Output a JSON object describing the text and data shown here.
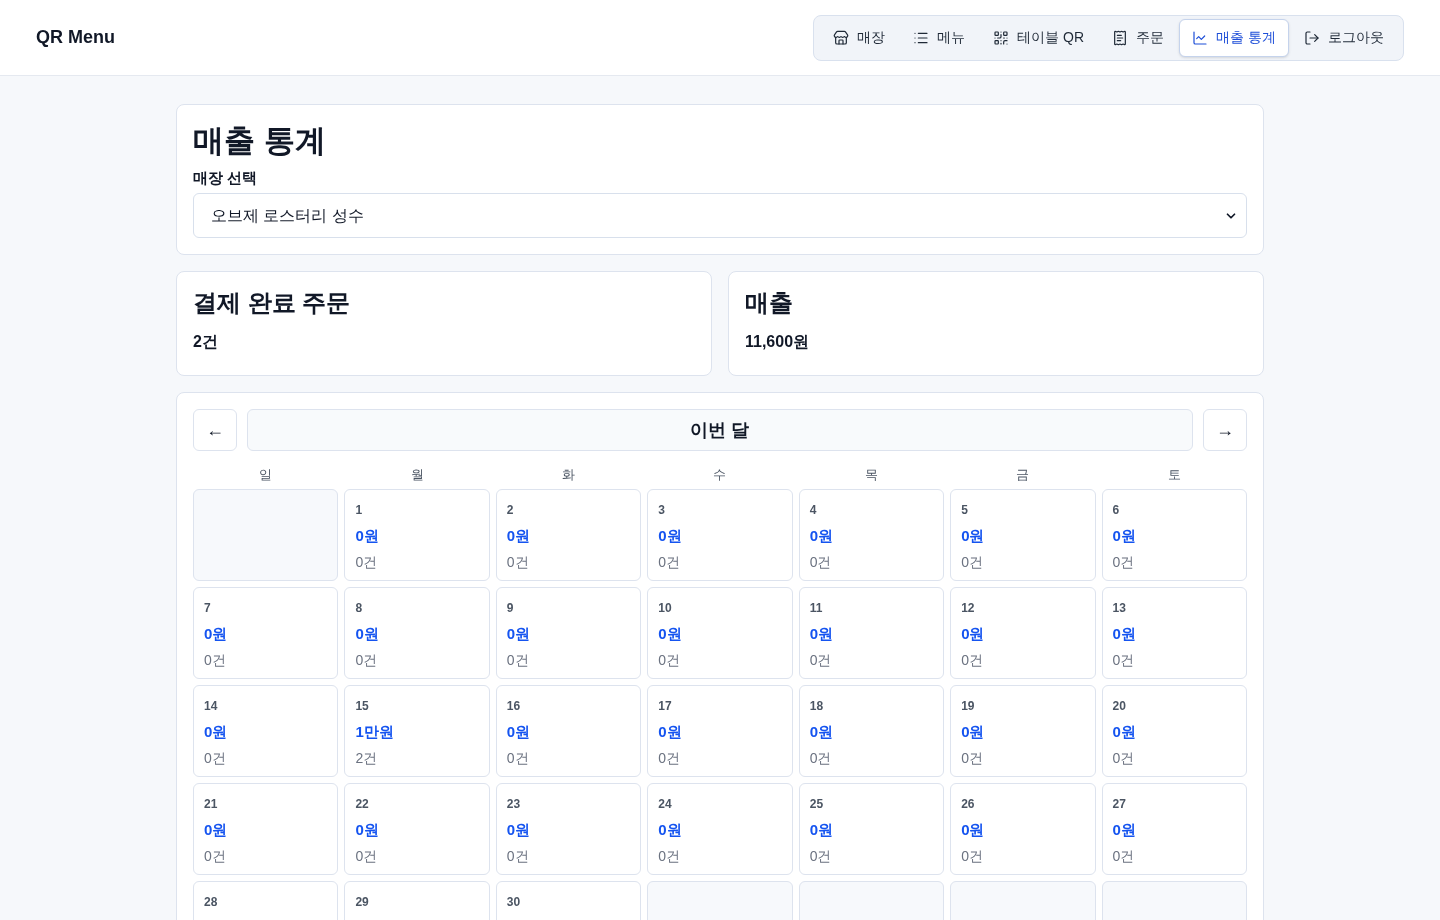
{
  "header": {
    "logo": "QR Menu",
    "nav": [
      {
        "label": "매장",
        "selected": false
      },
      {
        "label": "메뉴",
        "selected": false
      },
      {
        "label": "테이블 QR",
        "selected": false
      },
      {
        "label": "주문",
        "selected": false
      },
      {
        "label": "매출 통계",
        "selected": true
      },
      {
        "label": "로그아웃",
        "selected": false
      }
    ]
  },
  "stats_panel": {
    "title": "매출 통계",
    "store_select": {
      "label": "매장 선택",
      "value": "오브제 로스터리 성수"
    }
  },
  "summary": [
    {
      "title": "결제 완료 주문",
      "value": "2건"
    },
    {
      "title": "매출",
      "value": "11,600원"
    }
  ],
  "calendar": {
    "prev": "←",
    "month_label": "이번 달",
    "next": "→",
    "weekdays": [
      "일",
      "월",
      "화",
      "수",
      "목",
      "금",
      "토"
    ],
    "weeks": [
      [
        {
          "kind": "empty"
        },
        {
          "kind": "day",
          "day": "1",
          "amount": "0원",
          "count": "0건"
        },
        {
          "kind": "day",
          "day": "2",
          "amount": "0원",
          "count": "0건"
        },
        {
          "kind": "day",
          "day": "3",
          "amount": "0원",
          "count": "0건"
        },
        {
          "kind": "day",
          "day": "4",
          "amount": "0원",
          "count": "0건"
        },
        {
          "kind": "day",
          "day": "5",
          "amount": "0원",
          "count": "0건"
        },
        {
          "kind": "day",
          "day": "6",
          "amount": "0원",
          "count": "0건"
        }
      ],
      [
        {
          "kind": "day",
          "day": "7",
          "amount": "0원",
          "count": "0건"
        },
        {
          "kind": "day",
          "day": "8",
          "amount": "0원",
          "count": "0건"
        },
        {
          "kind": "day",
          "day": "9",
          "amount": "0원",
          "count": "0건"
        },
        {
          "kind": "day",
          "day": "10",
          "amount": "0원",
          "count": "0건"
        },
        {
          "kind": "day",
          "day": "11",
          "amount": "0원",
          "count": "0건"
        },
        {
          "kind": "day",
          "day": "12",
          "amount": "0원",
          "count": "0건"
        },
        {
          "kind": "day",
          "day": "13",
          "amount": "0원",
          "count": "0건"
        }
      ],
      [
        {
          "kind": "day",
          "day": "14",
          "amount": "0원",
          "count": "0건"
        },
        {
          "kind": "day",
          "day": "15",
          "amount": "1만원",
          "count": "2건"
        },
        {
          "kind": "day",
          "day": "16",
          "amount": "0원",
          "count": "0건"
        },
        {
          "kind": "day",
          "day": "17",
          "amount": "0원",
          "count": "0건"
        },
        {
          "kind": "day",
          "day": "18",
          "amount": "0원",
          "count": "0건"
        },
        {
          "kind": "day",
          "day": "19",
          "amount": "0원",
          "count": "0건"
        },
        {
          "kind": "day",
          "day": "20",
          "amount": "0원",
          "count": "0건"
        }
      ],
      [
        {
          "kind": "day",
          "day": "21",
          "amount": "0원",
          "count": "0건"
        },
        {
          "kind": "day",
          "day": "22",
          "amount": "0원",
          "count": "0건"
        },
        {
          "kind": "day",
          "day": "23",
          "amount": "0원",
          "count": "0건"
        },
        {
          "kind": "day",
          "day": "24",
          "amount": "0원",
          "count": "0건"
        },
        {
          "kind": "day",
          "day": "25",
          "amount": "0원",
          "count": "0건"
        },
        {
          "kind": "day",
          "day": "26",
          "amount": "0원",
          "count": "0건"
        },
        {
          "kind": "day",
          "day": "27",
          "amount": "0원",
          "count": "0건"
        }
      ],
      [
        {
          "kind": "day",
          "day": "28"
        },
        {
          "kind": "day",
          "day": "29"
        },
        {
          "kind": "day",
          "day": "30"
        },
        {
          "kind": "empty"
        },
        {
          "kind": "empty"
        },
        {
          "kind": "empty"
        },
        {
          "kind": "empty"
        }
      ]
    ]
  }
}
